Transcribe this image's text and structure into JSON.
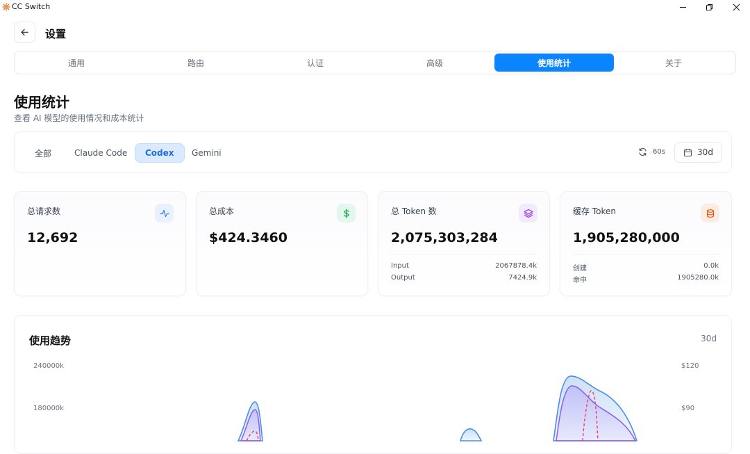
{
  "app": {
    "title": "CC Switch"
  },
  "header": {
    "title": "设置"
  },
  "tabs": [
    {
      "label": "通用",
      "active": false
    },
    {
      "label": "路由",
      "active": false
    },
    {
      "label": "认证",
      "active": false
    },
    {
      "label": "高级",
      "active": false
    },
    {
      "label": "使用统计",
      "active": true
    },
    {
      "label": "关于",
      "active": false
    }
  ],
  "section": {
    "title": "使用统计",
    "subtitle": "查看 AI 模型的使用情况和成本统计"
  },
  "filters": {
    "apps": [
      "全部",
      "Claude Code",
      "Codex",
      "Gemini"
    ],
    "active_app": "Codex",
    "refresh_interval": "60s",
    "range": "30d"
  },
  "cards": {
    "requests": {
      "label": "总请求数",
      "value": "12,692",
      "icon": "activity-icon"
    },
    "cost": {
      "label": "总成本",
      "value": "$424.3460",
      "icon": "dollar-icon"
    },
    "tokens": {
      "label": "总 Token 数",
      "value": "2,075,303,284",
      "icon": "layers-icon",
      "rows": [
        {
          "label": "Input",
          "value": "2067878.4k"
        },
        {
          "label": "Output",
          "value": "7424.9k"
        }
      ]
    },
    "cache": {
      "label": "缓存 Token",
      "value": "1,905,280,000",
      "icon": "database-icon",
      "rows": [
        {
          "label": "创建",
          "value": "0.0k"
        },
        {
          "label": "命中",
          "value": "1905280.0k"
        }
      ]
    }
  },
  "trend": {
    "title": "使用趋势",
    "range": "30d",
    "y_left_ticks": [
      "240000k",
      "180000k"
    ],
    "y_right_ticks": [
      "$120",
      "$90"
    ]
  },
  "colors": {
    "accent": "#0a84ff",
    "series_total": "#4a90e2",
    "series_input": "#8b5cf6",
    "series_cost": "#ef4469"
  }
}
